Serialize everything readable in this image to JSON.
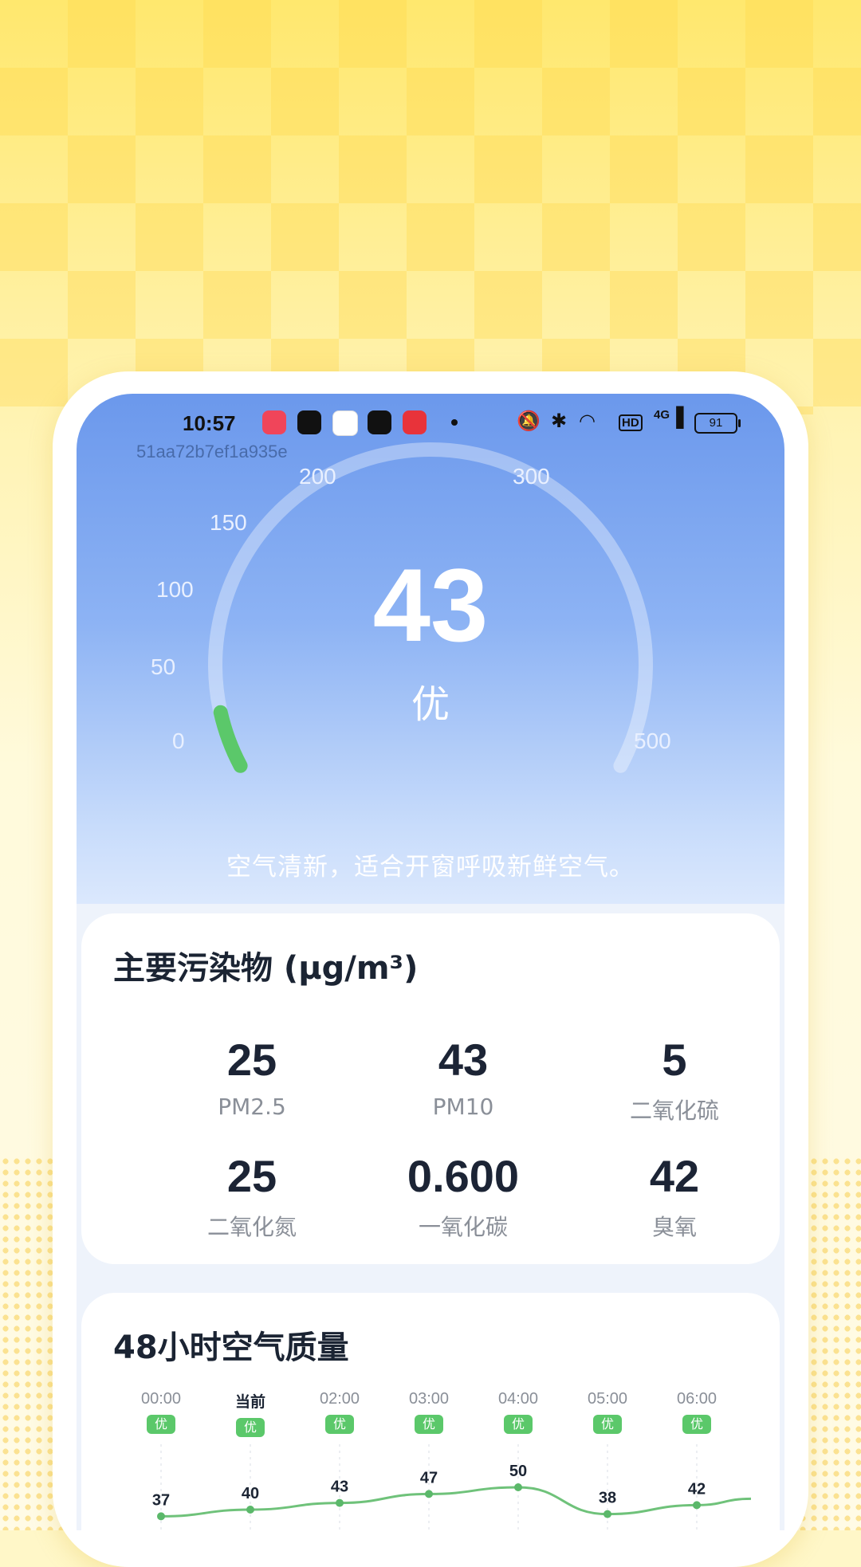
{
  "status_bar": {
    "time": "10:57",
    "battery": "91",
    "network": "4G",
    "hd": "HD"
  },
  "device_id": "51aa72b7ef1a935e",
  "aqi": {
    "value": "43",
    "level": "优",
    "value_num": 43,
    "max": 500,
    "advice": "空气清新，适合开窗呼吸新鲜空气。"
  },
  "gauge_ticks": [
    "0",
    "50",
    "100",
    "150",
    "200",
    "300",
    "500"
  ],
  "pollutants": {
    "title": "主要污染物 (μg/m³)",
    "items": [
      {
        "value": "25",
        "name": "PM2.5"
      },
      {
        "value": "43",
        "name": "PM10"
      },
      {
        "value": "5",
        "name": "二氧化硫"
      },
      {
        "value": "25",
        "name": "二氧化氮"
      },
      {
        "value": "0.600",
        "name": "一氧化碳"
      },
      {
        "value": "42",
        "name": "臭氧"
      }
    ]
  },
  "forecast": {
    "title": "48小时空气质量",
    "hours": [
      {
        "label": "00:00",
        "badge": "优",
        "value": 37
      },
      {
        "label": "当前",
        "badge": "优",
        "value": 40
      },
      {
        "label": "02:00",
        "badge": "优",
        "value": 43
      },
      {
        "label": "03:00",
        "badge": "优",
        "value": 47
      },
      {
        "label": "04:00",
        "badge": "优",
        "value": 50
      },
      {
        "label": "05:00",
        "badge": "优",
        "value": 38
      },
      {
        "label": "06:00",
        "badge": "优",
        "value": 42
      }
    ]
  },
  "chart_data": {
    "type": "line",
    "title": "48小时空气质量",
    "categories": [
      "00:00",
      "当前",
      "02:00",
      "03:00",
      "04:00",
      "05:00",
      "06:00"
    ],
    "values": [
      37,
      40,
      43,
      47,
      50,
      38,
      42
    ],
    "level_labels": [
      "优",
      "优",
      "优",
      "优",
      "优",
      "优",
      "优"
    ]
  },
  "colors": {
    "good": "#5bc86a",
    "hero_top": "#6b98ec",
    "text_dark": "#1b2433"
  }
}
